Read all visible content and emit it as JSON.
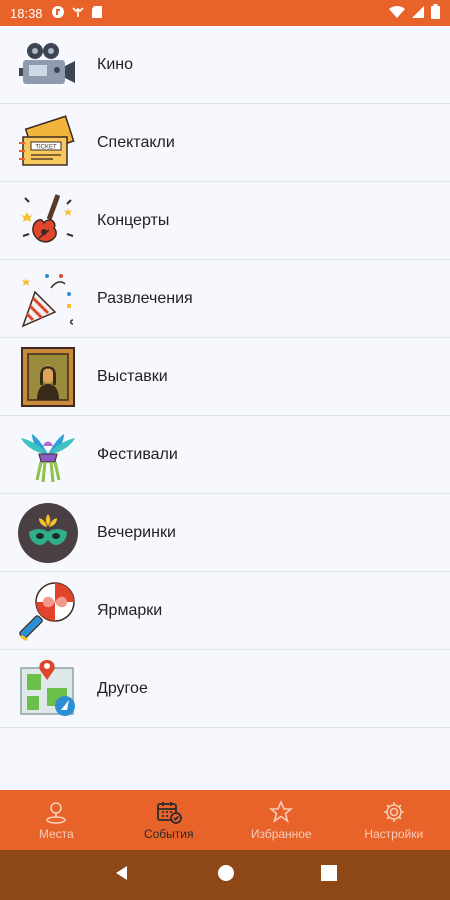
{
  "status_bar": {
    "time": "18:38"
  },
  "categories": [
    {
      "label": "Кино",
      "icon": "film-camera-icon"
    },
    {
      "label": "Спектакли",
      "icon": "ticket-icon"
    },
    {
      "label": "Концерты",
      "icon": "guitar-icon"
    },
    {
      "label": "Развлечения",
      "icon": "party-popper-icon"
    },
    {
      "label": "Выставки",
      "icon": "painting-icon"
    },
    {
      "label": "Фестивали",
      "icon": "festival-mask-icon"
    },
    {
      "label": "Вечеринки",
      "icon": "party-mask-icon"
    },
    {
      "label": "Ярмарки",
      "icon": "lollipop-icon"
    },
    {
      "label": "Другое",
      "icon": "map-icon"
    }
  ],
  "bottom_nav": [
    {
      "label": "Места",
      "icon": "places-pin-icon",
      "active": false
    },
    {
      "label": "События",
      "icon": "calendar-icon",
      "active": true
    },
    {
      "label": "Избранное",
      "icon": "star-icon",
      "active": false
    },
    {
      "label": "Настройки",
      "icon": "gear-icon",
      "active": false
    }
  ],
  "colors": {
    "primary": "#e8632a",
    "nav_bar": "#8e4716",
    "list_bg": "#f5f7fc"
  }
}
